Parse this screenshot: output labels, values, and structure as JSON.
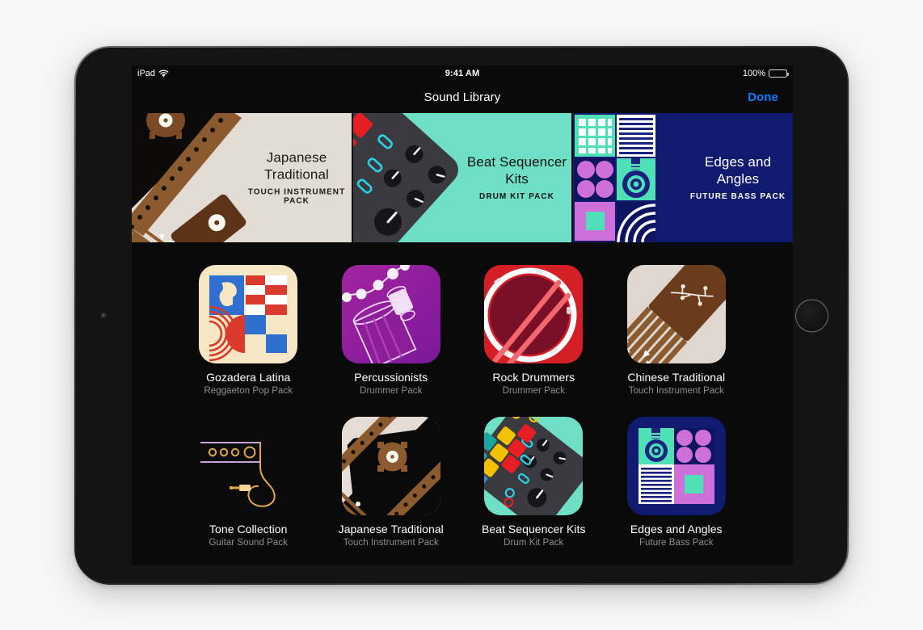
{
  "status_bar": {
    "device_label": "iPad",
    "wifi_icon": "wifi-icon",
    "time": "9:41 AM",
    "battery_percent": "100%",
    "battery_icon": "battery-full-icon"
  },
  "nav_bar": {
    "title": "Sound Library",
    "done_label": "Done"
  },
  "banners": [
    {
      "id": "japanese-traditional",
      "title_line1": "Japanese",
      "title_line2": "Traditional",
      "subtitle": "TOUCH INSTRUMENT PACK",
      "bg": "#e3dcd4",
      "text_color": "#1a1a1a"
    },
    {
      "id": "beat-sequencer-kits",
      "title_line1": "Beat Sequencer",
      "title_line2": "Kits",
      "subtitle": "DRUM KIT PACK",
      "bg": "#6fdfc6",
      "text_color": "#121212"
    },
    {
      "id": "edges-and-angles",
      "title_line1": "Edges and",
      "title_line2": "Angles",
      "subtitle": "FUTURE BASS PACK",
      "bg": "#101a6e",
      "text_color": "#ffffff"
    }
  ],
  "packs": [
    {
      "id": "gozadera-latina",
      "title": "Gozadera Latina",
      "subtitle": "Reggaeton Pop Pack"
    },
    {
      "id": "percussionists",
      "title": "Percussionists",
      "subtitle": "Drummer Pack"
    },
    {
      "id": "rock-drummers",
      "title": "Rock Drummers",
      "subtitle": "Drummer Pack"
    },
    {
      "id": "chinese-traditional",
      "title": "Chinese Traditional",
      "subtitle": "Touch Instrument Pack"
    },
    {
      "id": "tone-collection",
      "title": "Tone Collection",
      "subtitle": "Guitar Sound Pack"
    },
    {
      "id": "japanese-traditional",
      "title": "Japanese Traditional",
      "subtitle": "Touch Instrument Pack"
    },
    {
      "id": "beat-sequencer-kits",
      "title": "Beat Sequencer Kits",
      "subtitle": "Drum Kit Pack"
    },
    {
      "id": "edges-and-angles",
      "title": "Edges and Angles",
      "subtitle": "Future Bass Pack"
    }
  ],
  "colors": {
    "screen_bg": "#0a0a0a",
    "accent_blue": "#0a7cff",
    "label_primary": "#ffffff",
    "label_secondary": "#8e8e92",
    "page_bg": "#f6f6f6"
  }
}
